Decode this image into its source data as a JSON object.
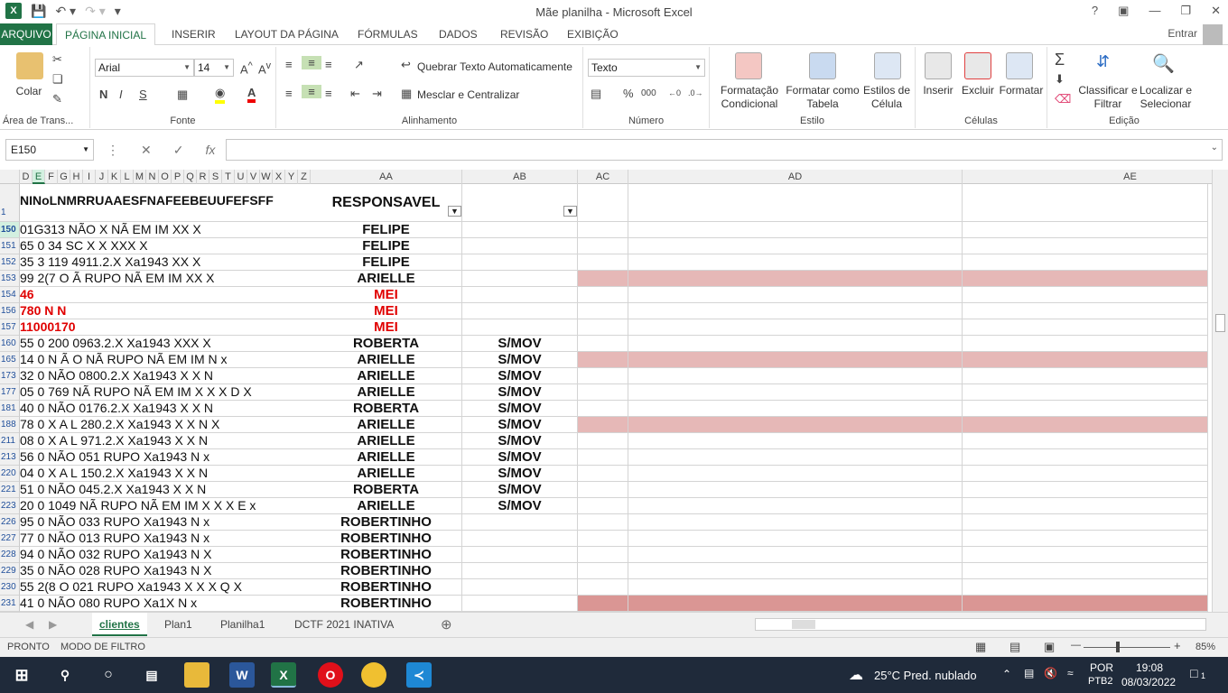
{
  "window": {
    "title": "Mãe planilha - Microsoft Excel",
    "help": "?",
    "entrar": "Entrar"
  },
  "menu": {
    "file": "ARQUIVO",
    "tabs": [
      "PÁGINA INICIAL",
      "INSERIR",
      "LAYOUT DA PÁGINA",
      "FÓRMULAS",
      "DADOS",
      "REVISÃO",
      "EXIBIÇÃO"
    ]
  },
  "ribbon": {
    "clipboard": {
      "paste": "Colar",
      "label": "Área de Trans..."
    },
    "font": {
      "name": "Arial",
      "size": "14",
      "bold": "N",
      "italic": "I",
      "underline": "S",
      "label": "Fonte"
    },
    "alignment": {
      "wrap": "Quebrar Texto Automaticamente",
      "merge": "Mesclar e Centralizar",
      "label": "Alinhamento"
    },
    "number": {
      "format": "Texto",
      "percent": "%",
      "thousands": "000",
      "label": "Número"
    },
    "styles": {
      "conditional": "Formatação Condicional",
      "table": "Formatar como Tabela",
      "cell": "Estilos de Célula",
      "label": "Estilo"
    },
    "cells": {
      "insert": "Inserir",
      "delete": "Excluir",
      "format": "Formatar",
      "label": "Células"
    },
    "editing": {
      "sort": "Classificar e Filtrar",
      "find": "Localizar e Selecionar",
      "label": "Edição"
    }
  },
  "formula_bar": {
    "name_box": "E150",
    "fx": "fx",
    "value": ""
  },
  "columns": {
    "narrow": [
      "D",
      "E",
      "F",
      "G",
      "H",
      "I",
      "J",
      "K",
      "L",
      "M",
      "N",
      "O",
      "P",
      "Q",
      "R",
      "S",
      "T",
      "U",
      "V",
      "W",
      "X",
      "Y",
      "Z"
    ],
    "wide": [
      "AA",
      "AB",
      "AC",
      "AD",
      "AE"
    ]
  },
  "header_row": {
    "row": "1",
    "narrow_text": "NINoLNMRRUAAESFNAFEEBEUUFEFSFF",
    "aa": "RESPONSAVEL"
  },
  "rows": [
    {
      "row": "150",
      "narrow": "01G313 NÃO   X  NÃ EM IM     XX         X",
      "aa": "FELIPE",
      "ab": "",
      "pink": false
    },
    {
      "row": "151",
      "narrow": "65 0 34 SC    X   X         XXX         X",
      "aa": "FELIPE",
      "ab": "",
      "pink": false
    },
    {
      "row": "152",
      "narrow": "35 3 119 4911.2.X   Xa1943    XX        X",
      "aa": "FELIPE",
      "ab": "",
      "pink": false
    },
    {
      "row": "153",
      "narrow": "99 2(7 O Ã RUPO NÃ EM IM     XX         X",
      "aa": "ARIELLE",
      "ab": "",
      "pink": true
    },
    {
      "row": "154",
      "narrow": "46",
      "aa": "MEI",
      "ab": "",
      "pink": false,
      "red": true
    },
    {
      "row": "156",
      "narrow": "780 N    N",
      "aa": "MEI",
      "ab": "",
      "pink": false,
      "red": true
    },
    {
      "row": "157",
      "narrow": "11000170",
      "aa": "MEI",
      "ab": "",
      "pink": false,
      "red": true
    },
    {
      "row": "160",
      "narrow": "55 0 200 0963.2.X   Xa1943    XXX       X",
      "aa": "ROBERTA",
      "ab": "S/MOV",
      "pink": false
    },
    {
      "row": "165",
      "narrow": "14 0 N Ã O NÃ RUPO NÃ EM IM          N x",
      "aa": "ARIELLE",
      "ab": "S/MOV",
      "pink": true
    },
    {
      "row": "173",
      "narrow": "32 0 NÃO 0800.2.X   Xa1943    X  X     N",
      "aa": "ARIELLE",
      "ab": "S/MOV",
      "pink": false
    },
    {
      "row": "177",
      "narrow": "05 0 769 NÃ RUPO NÃ EM IM X X       X D X",
      "aa": "ARIELLE",
      "ab": "S/MOV",
      "pink": false
    },
    {
      "row": "181",
      "narrow": "40 0 NÃO 0176.2.X   Xa1943    X  X     N",
      "aa": "ROBERTA",
      "ab": "S/MOV",
      "pink": false
    },
    {
      "row": "188",
      "narrow": "78 0 X A L 280.2.X  Xa1943    X  X     N  X",
      "aa": "ARIELLE",
      "ab": "S/MOV",
      "pink": true
    },
    {
      "row": "211",
      "narrow": "08 0 X A L 971.2.X  Xa1943    X  X     N",
      "aa": "ARIELLE",
      "ab": "S/MOV",
      "pink": false
    },
    {
      "row": "213",
      "narrow": "56 0 NÃO 051 RUPO   Xa1943             N x",
      "aa": "ARIELLE",
      "ab": "S/MOV",
      "pink": false
    },
    {
      "row": "220",
      "narrow": "04 0 X A L 150.2.X  Xa1943    X  X     N",
      "aa": "ARIELLE",
      "ab": "S/MOV",
      "pink": false
    },
    {
      "row": "221",
      "narrow": "51 0 NÃO 045.2.X    Xa1943    X  X     N",
      "aa": "ROBERTA",
      "ab": "S/MOV",
      "pink": false
    },
    {
      "row": "223",
      "narrow": "20 0 1049 NÃ RUPO NÃ EM IM X X     X E x",
      "aa": "ARIELLE",
      "ab": "S/MOV",
      "pink": false
    },
    {
      "row": "226",
      "narrow": "95 0 NÃO 033 RUPO   Xa1943             N x",
      "aa": "ROBERTINHO",
      "ab": "",
      "pink": false
    },
    {
      "row": "227",
      "narrow": "77 0 NÃO 013 RUPO   Xa1943             N x",
      "aa": "ROBERTINHO",
      "ab": "",
      "pink": false
    },
    {
      "row": "228",
      "narrow": "94 0 NÃO 032 RUPO   Xa1943             N X",
      "aa": "ROBERTINHO",
      "ab": "",
      "pink": false
    },
    {
      "row": "229",
      "narrow": "35 0 NÃO 028 RUPO   Xa1943             N X",
      "aa": "ROBERTINHO",
      "ab": "",
      "pink": false
    },
    {
      "row": "230",
      "narrow": "55 2(8 O 021 RUPO   Xa1943 X X       X Q X",
      "aa": "ROBERTINHO",
      "ab": "",
      "pink": false
    },
    {
      "row": "231",
      "narrow": "41 0 NÃO 080 RUPO   Xa1X              N x",
      "aa": "ROBERTINHO",
      "ab": "",
      "pink": true,
      "dark": true
    }
  ],
  "sheet_tabs": [
    "clientes",
    "Plan1",
    "Planilha1",
    "DCTF 2021 INATIVA"
  ],
  "status": {
    "ready": "PRONTO",
    "mode": "MODO DE FILTRO",
    "zoom": "85%"
  },
  "taskbar": {
    "weather": "25°C  Pred. nublado",
    "lang": "POR",
    "layout": "PTB2",
    "time": "19:08",
    "date": "08/03/2022",
    "notif": "1"
  },
  "colors": {
    "accent": "#217346",
    "pink": "#e6b8b7",
    "red": "#e00000"
  }
}
